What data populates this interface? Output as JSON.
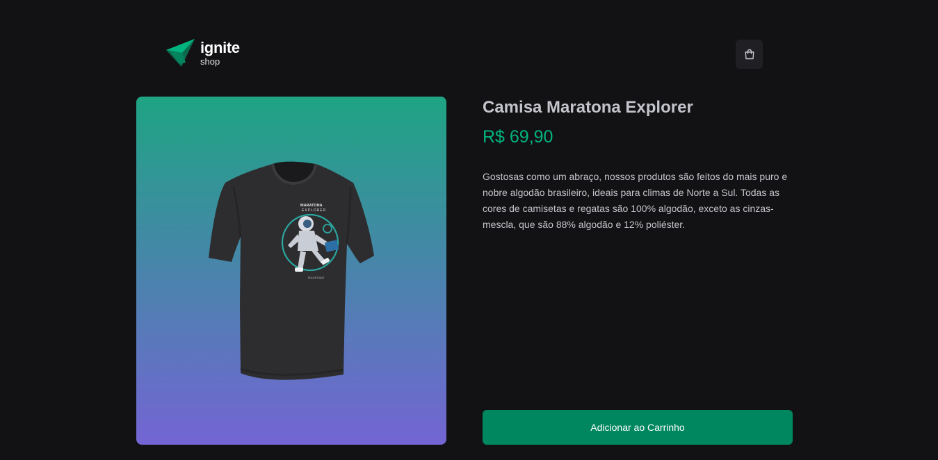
{
  "header": {
    "logo_title": "ignite",
    "logo_subtitle": "shop",
    "cart_icon": "shopping-bag-icon"
  },
  "product": {
    "name": "Camisa Maratona Explorer",
    "price": "R$ 69,90",
    "description": "Gostosas como um abraço, nossos produtos são feitos do mais puro e nobre algodão brasileiro, ideais para climas de Norte a Sul. Todas as cores de camisetas e regatas são 100% algodão, exceto as cinzas-mescla, que são 88% algodão e 12% poliéster.",
    "add_button_label": "Adicionar ao Carrinho",
    "print_title": "MARATONA",
    "print_subtitle": "EXPLORER",
    "print_brand": "ROCKETSEAT"
  },
  "colors": {
    "background": "#121214",
    "accent": "#00875f",
    "price": "#00b37e",
    "gradient_top": "#1ea483",
    "gradient_bottom": "#7465d4"
  }
}
